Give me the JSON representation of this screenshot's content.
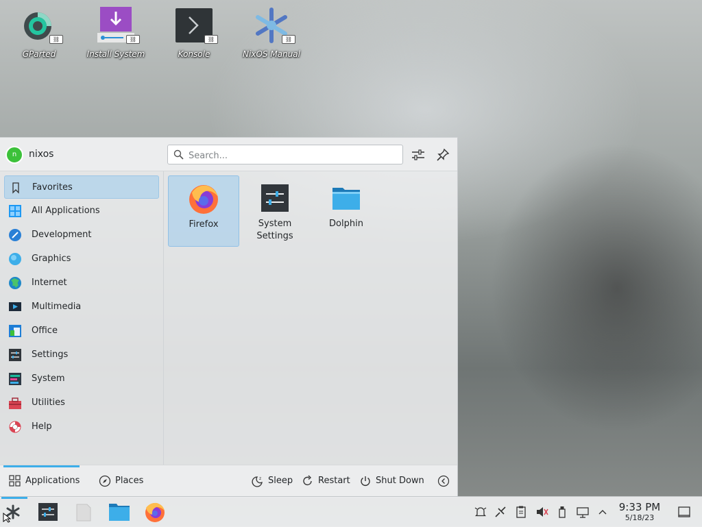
{
  "desktop": {
    "icons": [
      {
        "label": "GParted",
        "icon": "gparted-icon"
      },
      {
        "label": "Install System",
        "icon": "install-icon"
      },
      {
        "label": "Konsole",
        "icon": "konsole-icon"
      },
      {
        "label": "NixOS Manual",
        "icon": "nixos-snowflake-icon"
      }
    ]
  },
  "launcher": {
    "user": {
      "initial": "n",
      "name": "nixos"
    },
    "search": {
      "placeholder": "Search...",
      "value": ""
    },
    "categories": [
      {
        "label": "Favorites",
        "icon": "bookmark-icon",
        "selected": true
      },
      {
        "label": "All Applications",
        "icon": "grid-icon"
      },
      {
        "label": "Development",
        "icon": "development-icon"
      },
      {
        "label": "Graphics",
        "icon": "graphics-icon"
      },
      {
        "label": "Internet",
        "icon": "globe-icon"
      },
      {
        "label": "Multimedia",
        "icon": "multimedia-icon"
      },
      {
        "label": "Office",
        "icon": "office-icon"
      },
      {
        "label": "Settings",
        "icon": "settings-icon"
      },
      {
        "label": "System",
        "icon": "system-icon"
      },
      {
        "label": "Utilities",
        "icon": "toolbox-icon"
      },
      {
        "label": "Help",
        "icon": "lifebuoy-icon"
      }
    ],
    "favorites": [
      {
        "label": "Firefox",
        "icon": "firefox-icon",
        "selected": true
      },
      {
        "label": "System\nSettings",
        "icon": "system-settings-icon"
      },
      {
        "label": "Dolphin",
        "icon": "folder-icon"
      }
    ],
    "footer": {
      "tabs": [
        {
          "label": "Applications",
          "selected": true
        },
        {
          "label": "Places"
        }
      ],
      "actions": [
        {
          "label": "Sleep"
        },
        {
          "label": "Restart"
        },
        {
          "label": "Shut Down"
        }
      ]
    }
  },
  "taskbar": {
    "clock": {
      "time": "9:33 PM",
      "date": "5/18/23"
    }
  },
  "colors": {
    "accent": "#3daee9",
    "selection": "#afd2eb",
    "avatar": "#3cc13a"
  }
}
